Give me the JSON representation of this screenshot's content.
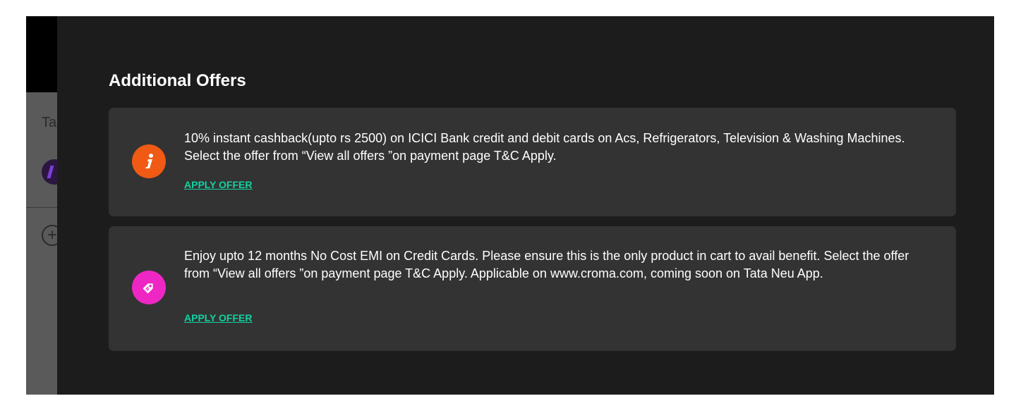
{
  "background_page": {
    "partial_label": "Ta"
  },
  "modal": {
    "title": "Additional Offers",
    "offers": [
      {
        "icon": "info-icon",
        "icon_color": "#f05a14",
        "text": "10% instant cashback(upto rs 2500) on ICICI Bank credit and debit cards on Acs, Refrigerators, Television & Washing Machines. Select the offer from “View all offers ”on payment page T&C Apply.",
        "action_label": "APPLY OFFER"
      },
      {
        "icon": "price-tag-icon",
        "icon_color": "#ee27c4",
        "text": "Enjoy upto 12 months No Cost EMI on Credit Cards. Please ensure this is the only product in cart to avail benefit. Select the offer from “View all offers ”on payment page T&C Apply. Applicable on www.croma.com, coming soon on Tata Neu App.",
        "action_label": "APPLY OFFER"
      }
    ]
  },
  "colors": {
    "modal_background": "#1c1c1c",
    "card_background": "#333333",
    "link_accent": "#11d3a2"
  }
}
